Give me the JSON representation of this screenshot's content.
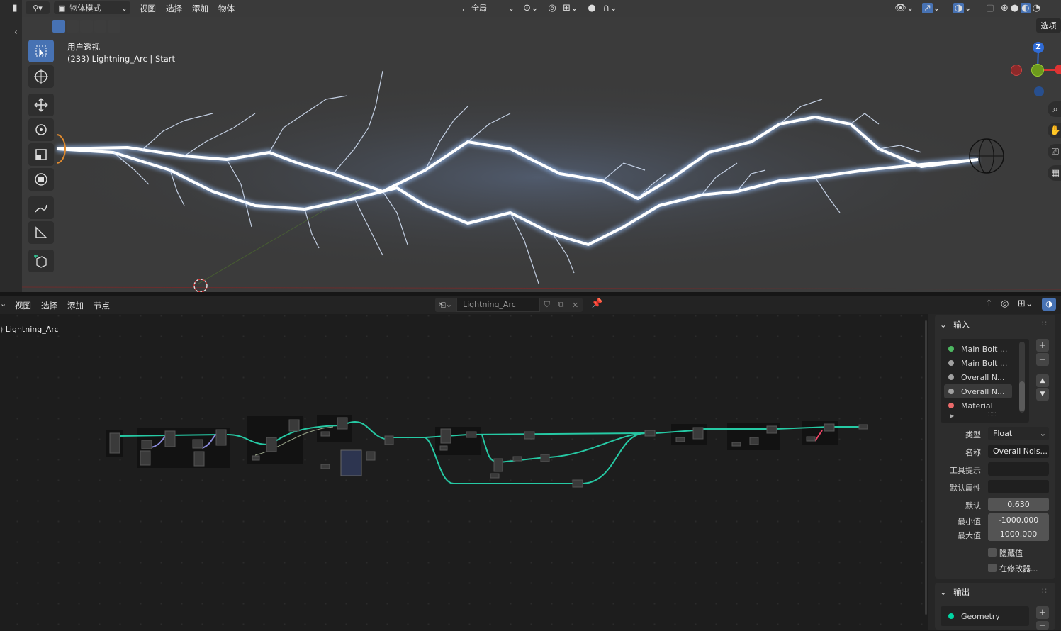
{
  "viewport": {
    "mode_label": "物体模式",
    "menus": [
      "视图",
      "选择",
      "添加",
      "物体"
    ],
    "transform_orientation": "全局",
    "view_name": "用户透视",
    "object_info": "(233) Lightning_Arc | Start",
    "options_label": "选项",
    "gizmo_axis_z": "Z"
  },
  "node_editor": {
    "menus": [
      "视图",
      "选择",
      "添加",
      "节点"
    ],
    "node_group_name": "Lightning_Arc",
    "breadcrumb": "Lightning_Arc"
  },
  "panel": {
    "inputs_title": "输入",
    "inputs": [
      {
        "label": "Main Bolt ...",
        "color": "#4db861"
      },
      {
        "label": "Main Bolt ...",
        "color": "#a1a1a1"
      },
      {
        "label": "Overall N...",
        "color": "#a1a1a1"
      },
      {
        "label": "Overall N...",
        "color": "#a1a1a1",
        "selected": true
      },
      {
        "label": "Material",
        "color": "#eb6a6a"
      }
    ],
    "type_label": "类型",
    "type_value": "Float",
    "name_label": "名称",
    "name_value": "Overall Nois...",
    "tooltip_label": "工具提示",
    "tooltip_value": "",
    "default_attr_label": "默认属性",
    "default_attr_value": "",
    "default_label": "默认",
    "default_value": "0.630",
    "min_label": "最小值",
    "min_value": "-1000.000",
    "max_label": "最大值",
    "max_value": "1000.000",
    "hide_value_label": "隐藏值",
    "in_modifier_label": "在修改器...",
    "outputs_title": "输出",
    "outputs": [
      {
        "label": "Geometry",
        "color": "#00d6a3"
      }
    ]
  },
  "colors": {
    "accent": "#4772b3",
    "link": "#26c9a4",
    "header_bg": "#232323"
  }
}
